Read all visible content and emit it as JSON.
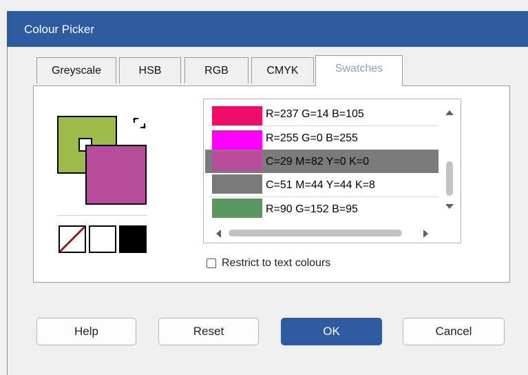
{
  "dialog": {
    "title": "Colour Picker"
  },
  "tabs": [
    {
      "label": "Greyscale"
    },
    {
      "label": "HSB"
    },
    {
      "label": "RGB"
    },
    {
      "label": "CMYK"
    },
    {
      "label": "Swatches",
      "active": true
    }
  ],
  "colours": {
    "fill": "#9ebc4e",
    "line": "#b84c9b",
    "swap_icon": "swap-arrows-icon"
  },
  "quick_swatches": [
    {
      "name": "none",
      "icon": "no-colour-icon"
    },
    {
      "name": "white",
      "color": "#ffffff"
    },
    {
      "name": "black",
      "color": "#000000"
    }
  ],
  "swatches": [
    {
      "color": "#ed0e69",
      "label": "R=237 G=14 B=105"
    },
    {
      "color": "#ff00ff",
      "label": "R=255 G=0 B=255"
    },
    {
      "color": "#b84c9b",
      "label": "C=29 M=82 Y=0 K=0",
      "selected": true
    },
    {
      "color": "#7a7a7a",
      "label": "C=51 M=44 Y=44 K=8"
    },
    {
      "color": "#5a985f",
      "label": "R=90 G=152 B=95"
    }
  ],
  "restrict": {
    "label": "Restrict to text colours",
    "checked": false
  },
  "buttons": {
    "help": "Help",
    "reset": "Reset",
    "ok": "OK",
    "cancel": "Cancel"
  }
}
